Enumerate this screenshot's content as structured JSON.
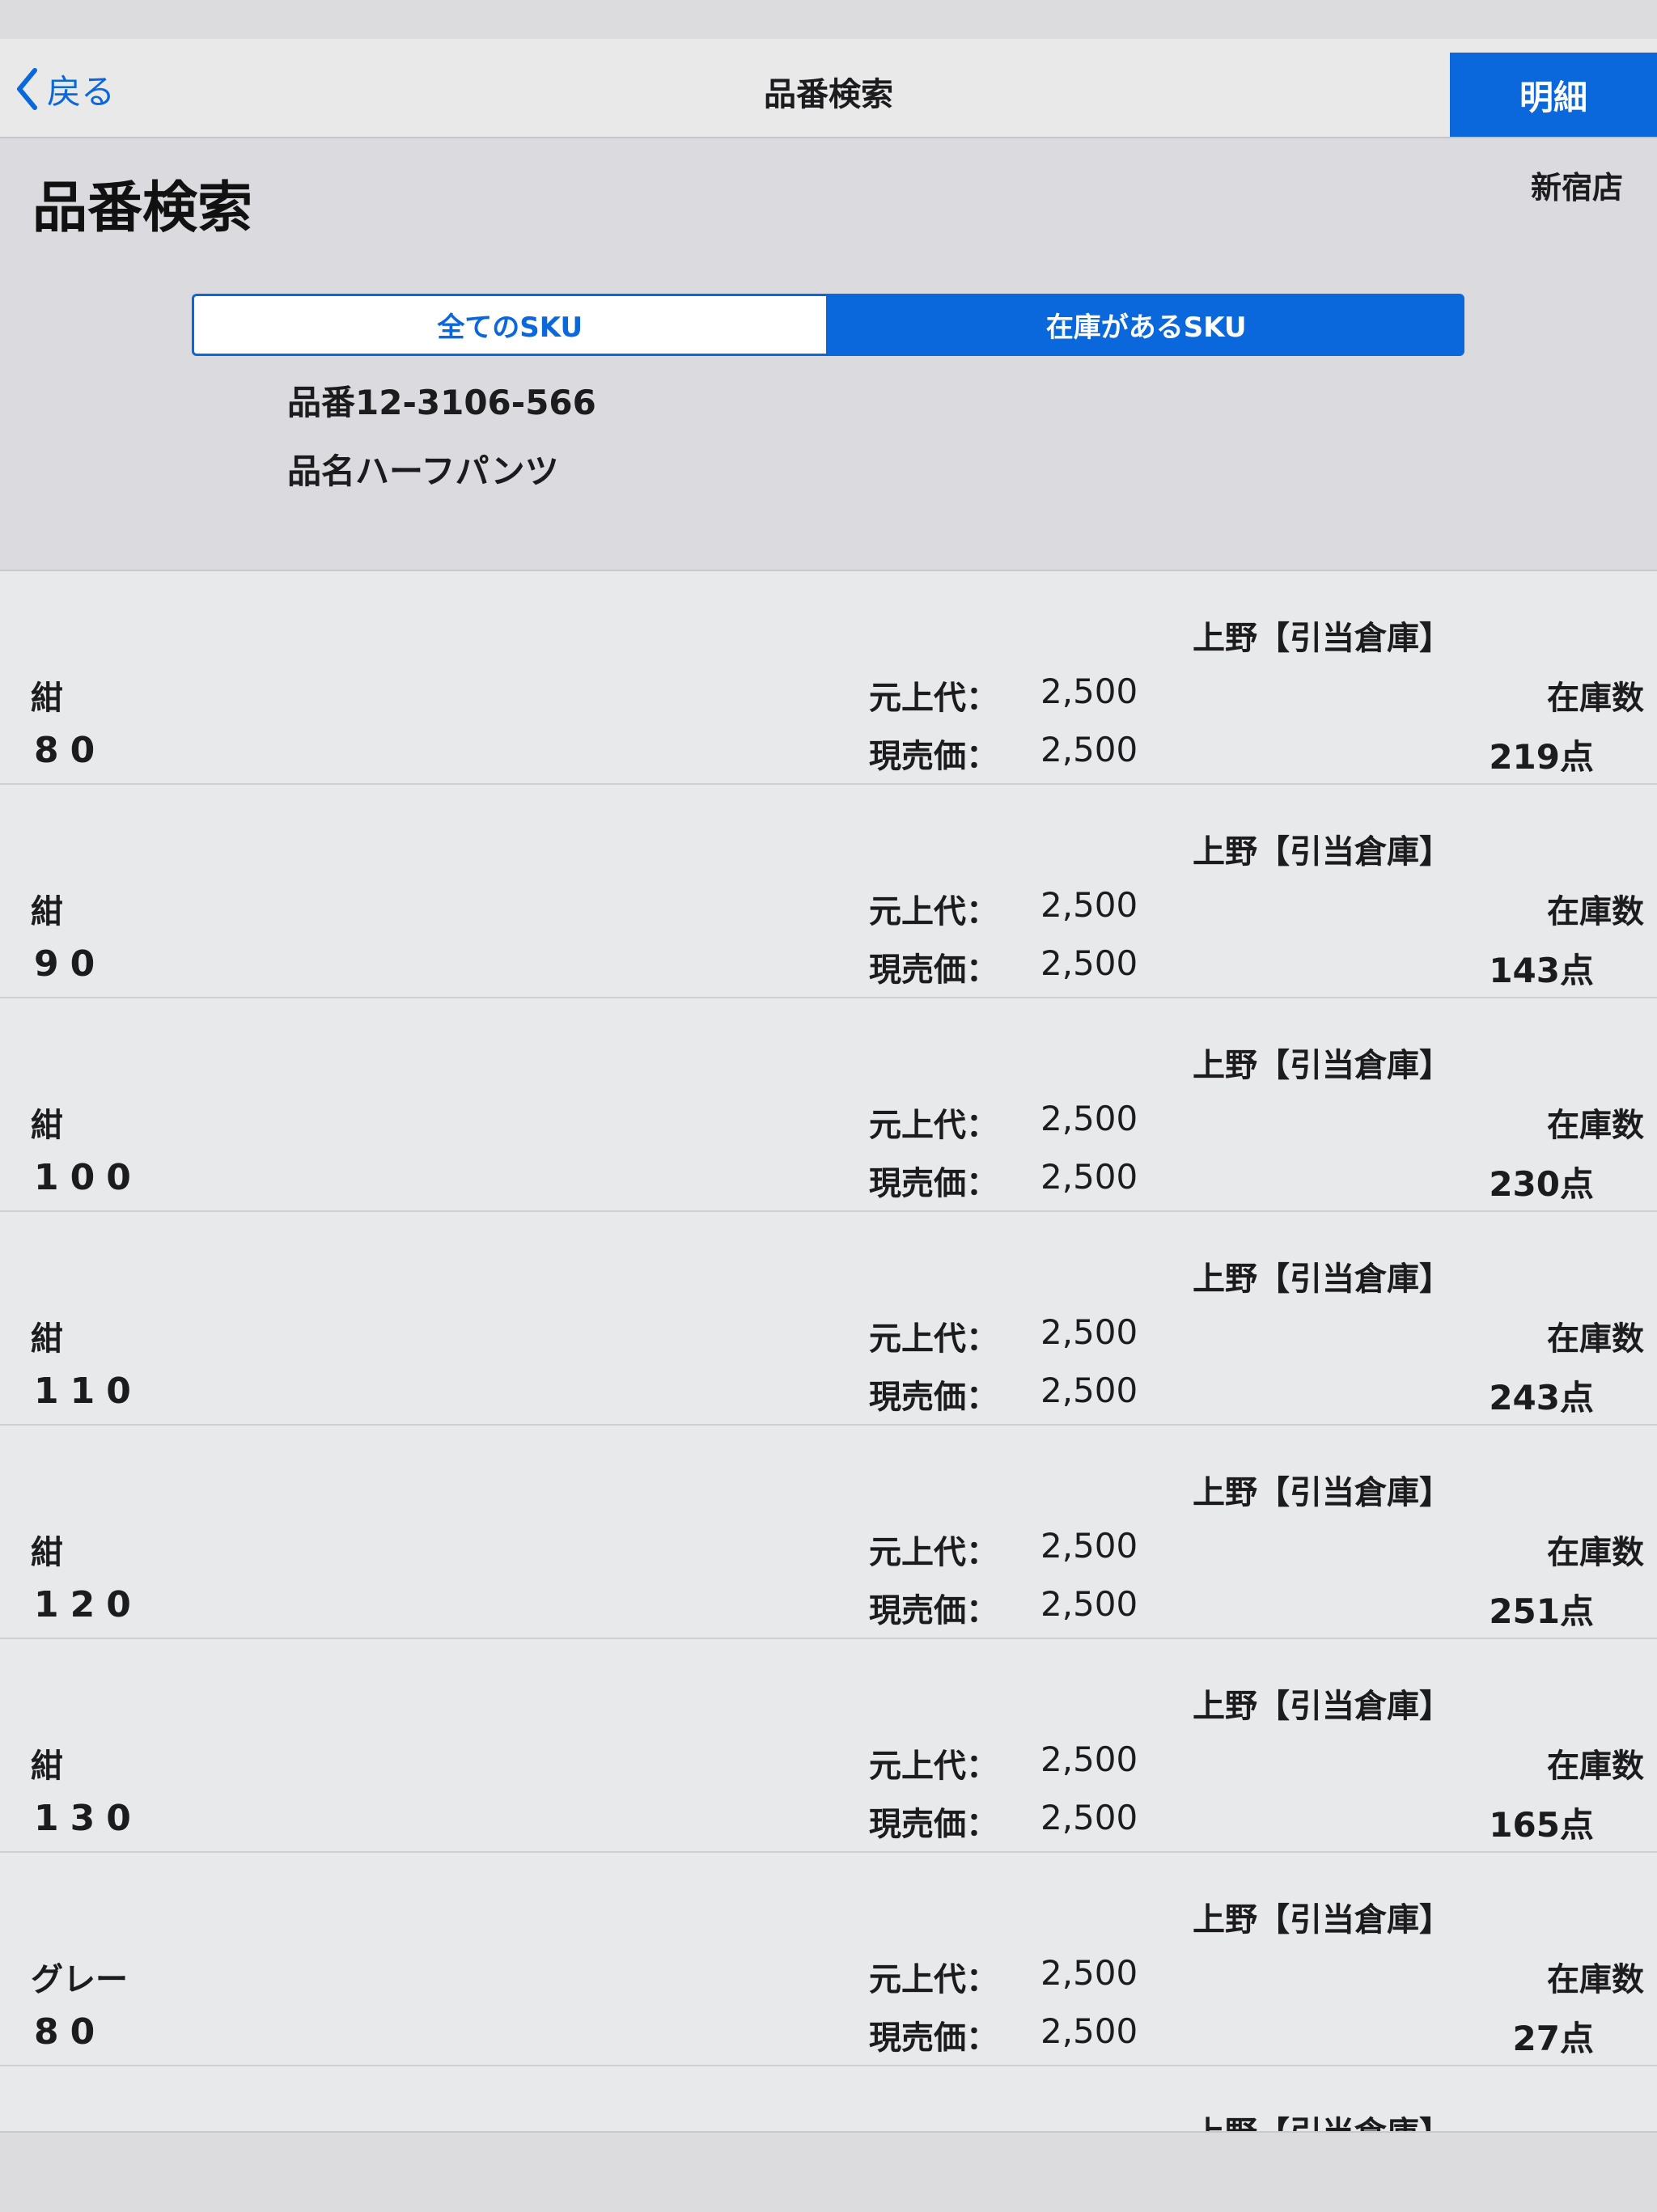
{
  "nav": {
    "back_label": "戻る",
    "title": "品番検索",
    "detail_label": "明細"
  },
  "header": {
    "page_title": "品番検索",
    "store": "新宿店",
    "segments": {
      "all_label": "全てのSKU",
      "in_stock_label": "在庫があるSKU",
      "selected": "在庫があるSKU"
    },
    "product_code": "品番12-3106-566",
    "product_name": "品名ハーフパンツ"
  },
  "labels": {
    "original_price": "元上代：",
    "current_price": "現売価：",
    "stock": "在庫数"
  },
  "items": [
    {
      "warehouse": "上野【引当倉庫】",
      "color": "紺",
      "size": "80",
      "original_price": "2,500",
      "current_price": "2,500",
      "stock": "219点"
    },
    {
      "warehouse": "上野【引当倉庫】",
      "color": "紺",
      "size": "90",
      "original_price": "2,500",
      "current_price": "2,500",
      "stock": "143点"
    },
    {
      "warehouse": "上野【引当倉庫】",
      "color": "紺",
      "size": "100",
      "original_price": "2,500",
      "current_price": "2,500",
      "stock": "230点"
    },
    {
      "warehouse": "上野【引当倉庫】",
      "color": "紺",
      "size": "110",
      "original_price": "2,500",
      "current_price": "2,500",
      "stock": "243点"
    },
    {
      "warehouse": "上野【引当倉庫】",
      "color": "紺",
      "size": "120",
      "original_price": "2,500",
      "current_price": "2,500",
      "stock": "251点"
    },
    {
      "warehouse": "上野【引当倉庫】",
      "color": "紺",
      "size": "130",
      "original_price": "2,500",
      "current_price": "2,500",
      "stock": "165点"
    },
    {
      "warehouse": "上野【引当倉庫】",
      "color": "グレー",
      "size": "80",
      "original_price": "2,500",
      "current_price": "2,500",
      "stock": "27点"
    },
    {
      "warehouse": "上野【引当倉庫】",
      "color": "",
      "size": "",
      "original_price": "",
      "current_price": "",
      "stock": ""
    }
  ],
  "colors": {
    "accent": "#0a67dc",
    "background": "#e8e9eb",
    "header_background": "#dadadf"
  }
}
